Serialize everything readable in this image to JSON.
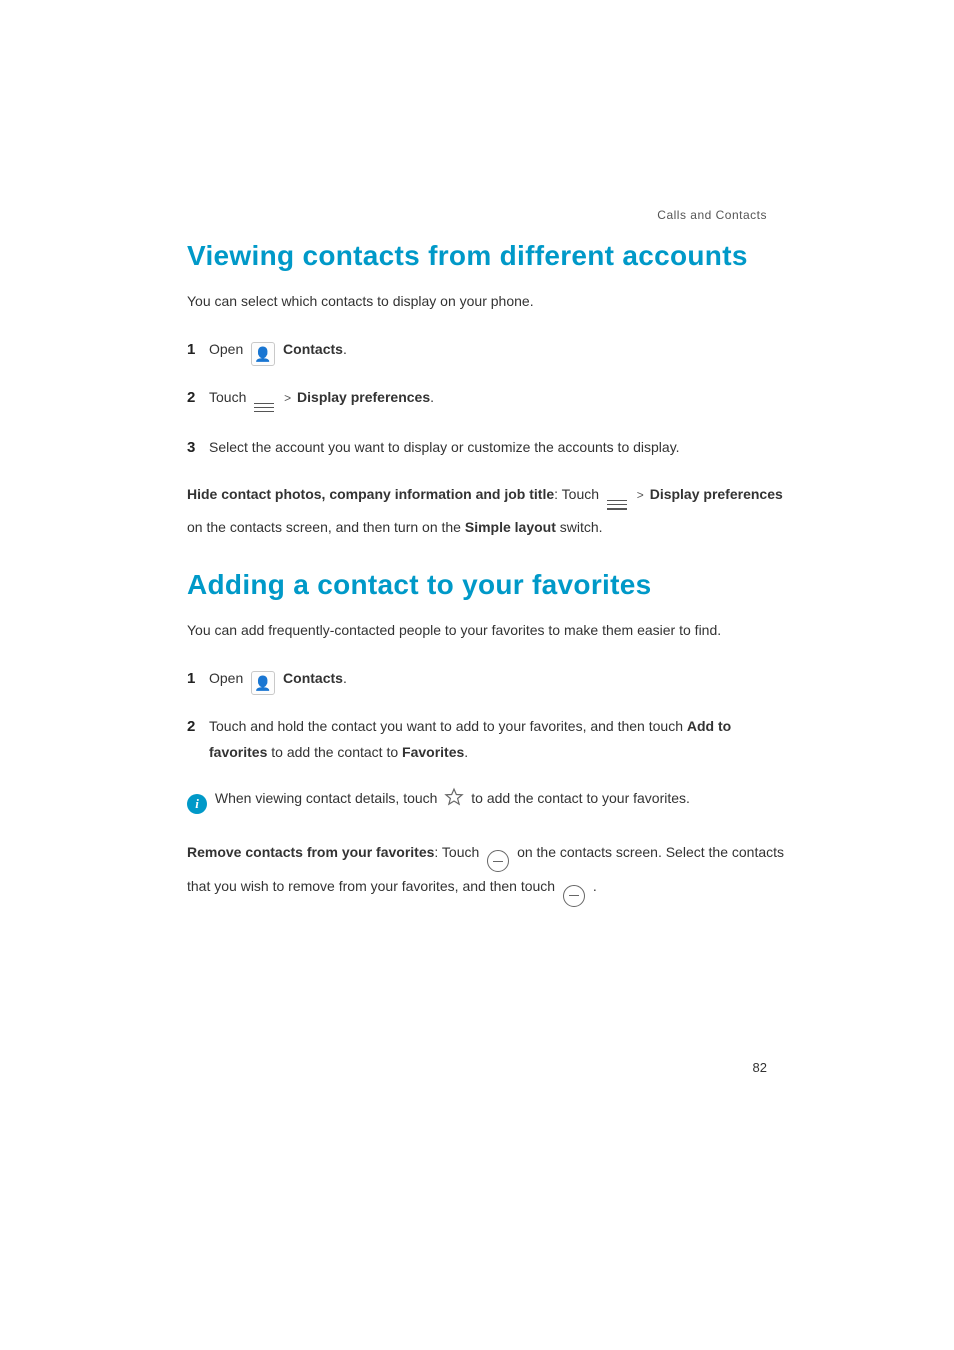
{
  "header": {
    "section_label": "Calls and Contacts"
  },
  "section1": {
    "title": "Viewing contacts from different accounts",
    "intro": "You can select which contacts to display on your phone.",
    "steps": {
      "s1_num": "1",
      "s1_open": "Open ",
      "s1_contacts": "Contacts",
      "s1_end": ".",
      "s2_num": "2",
      "s2_touch": "Touch ",
      "s2_gt": ">",
      "s2_disp": "Display preferences",
      "s2_end": ".",
      "s3_num": "3",
      "s3_text": "Select the account you want to display or customize the accounts to display."
    },
    "p2": {
      "bold1": "Hide contact photos, company information and job title",
      "t1": ": Touch ",
      "gt": ">",
      "bold2": "Display preferences",
      "t2": " on the contacts screen, and then turn on the ",
      "bold3": "Simple layout",
      "t3": " switch."
    }
  },
  "section2": {
    "title": "Adding a contact to your favorites",
    "intro": "You can add frequently-contacted people to your favorites to make them easier to find.",
    "steps": {
      "s1_num": "1",
      "s1_open": "Open ",
      "s1_contacts": "Contacts",
      "s1_end": ".",
      "s2_num": "2",
      "s2_a": "Touch and hold the contact you want to add to your favorites, and then touch ",
      "s2_b_bold": "Add to favorites",
      "s2_c": " to add the contact to ",
      "s2_d_bold": "Favorites",
      "s2_e": "."
    },
    "info": {
      "a": "When viewing contact details, touch ",
      "b": " to add the contact to your favorites."
    },
    "p2": {
      "bold1": "Remove contacts from your favorites",
      "t1": ": Touch ",
      "t2": " on the contacts screen. Select the contacts that you wish to remove from your favorites, and then touch ",
      "t3": " ."
    }
  },
  "page_number": "82",
  "icon_text": {
    "info": "i",
    "person": "👤"
  }
}
